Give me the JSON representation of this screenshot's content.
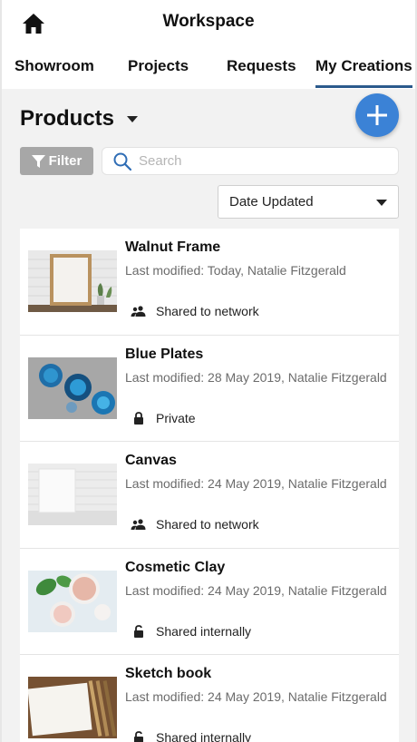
{
  "header": {
    "title": "Workspace",
    "home_icon": "home-icon"
  },
  "tabs": [
    {
      "label": "Showroom",
      "active": false
    },
    {
      "label": "Projects",
      "active": false
    },
    {
      "label": "Requests",
      "active": false
    },
    {
      "label": "My Creations",
      "active": true
    }
  ],
  "products": {
    "title": "Products",
    "add_icon": "plus-icon"
  },
  "filter": {
    "label": "Filter",
    "icon": "filter-funnel-icon"
  },
  "search": {
    "placeholder": "Search",
    "value": ""
  },
  "sort": {
    "selected": "Date Updated"
  },
  "items": [
    {
      "name": "Walnut Frame",
      "meta": "Last modified: Today, Natalie Fitzgerald",
      "sharing": "Shared to network",
      "sharing_icon": "people-icon"
    },
    {
      "name": "Blue Plates",
      "meta": "Last modified: 28 May 2019, Natalie Fitzgerald",
      "sharing": "Private",
      "sharing_icon": "lock-icon"
    },
    {
      "name": "Canvas",
      "meta": "Last modified: 24 May 2019, Natalie Fitzgerald",
      "sharing": "Shared to network",
      "sharing_icon": "people-icon"
    },
    {
      "name": "Cosmetic Clay",
      "meta": "Last modified: 24 May 2019, Natalie Fitzgerald",
      "sharing": "Shared internally",
      "sharing_icon": "unlock-icon"
    },
    {
      "name": "Sketch book",
      "meta": "Last modified: 24 May 2019, Natalie Fitzgerald",
      "sharing": "Shared internally",
      "sharing_icon": "unlock-icon"
    }
  ],
  "colors": {
    "accent": "#3b82d6",
    "tab_underline": "#2b5a8c",
    "filter_bg": "#a7a7a7"
  }
}
